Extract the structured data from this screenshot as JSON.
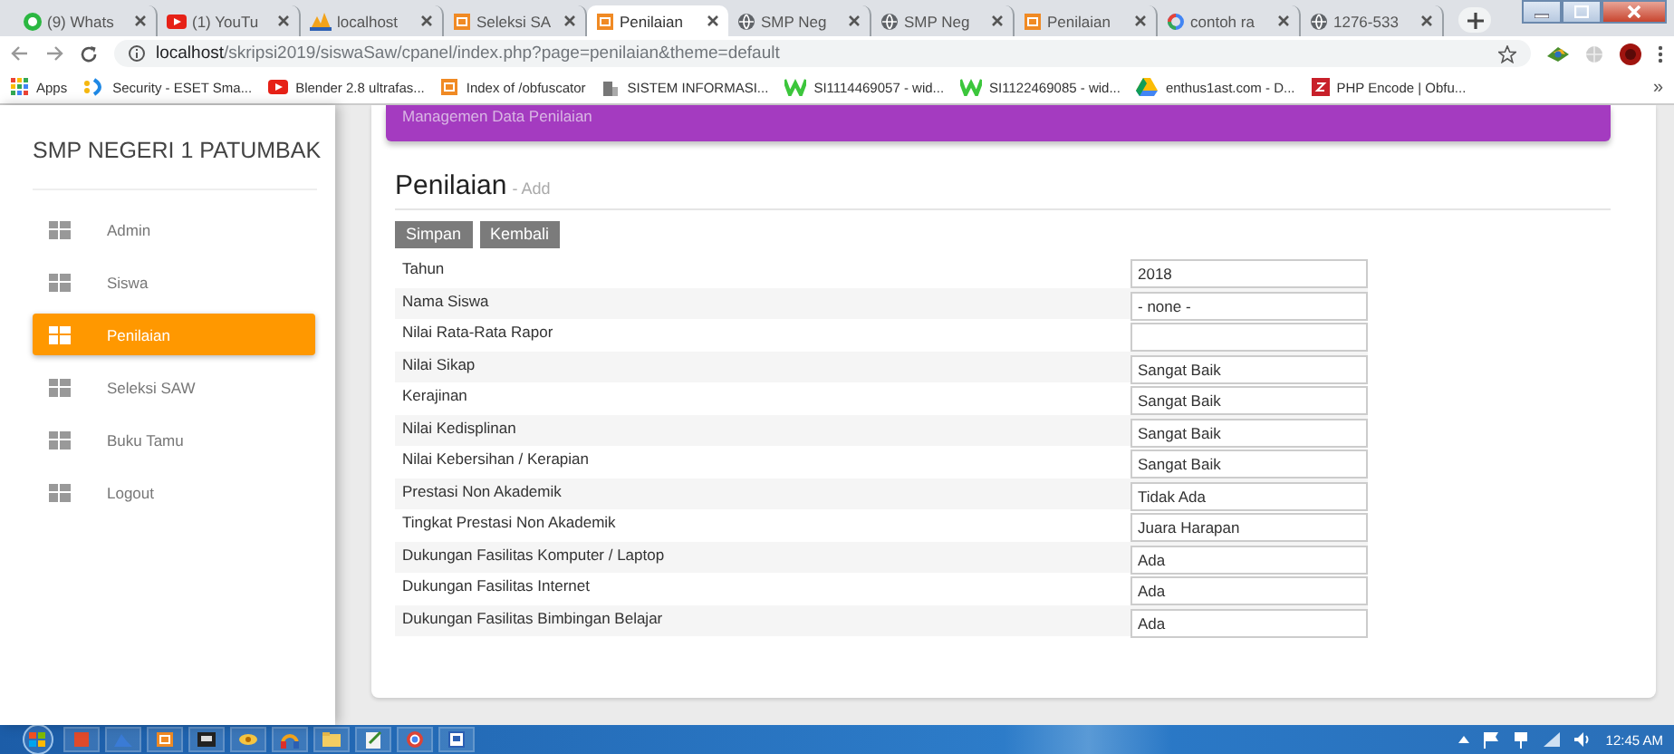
{
  "browser": {
    "tabs": [
      {
        "title": "(9) Whats",
        "kind": "whatsapp",
        "selected": false
      },
      {
        "title": "(1) YouTu",
        "kind": "youtube",
        "selected": false
      },
      {
        "title": "localhost",
        "kind": "mountain",
        "selected": false
      },
      {
        "title": "Seleksi SA",
        "kind": "square",
        "selected": false
      },
      {
        "title": "Penilaian",
        "kind": "square",
        "selected": true
      },
      {
        "title": "SMP Neg",
        "kind": "globe",
        "selected": false
      },
      {
        "title": "SMP Neg",
        "kind": "globe",
        "selected": false
      },
      {
        "title": "Penilaian",
        "kind": "square",
        "selected": false
      },
      {
        "title": "contoh ra",
        "kind": "ring",
        "selected": false
      },
      {
        "title": "1276-533",
        "kind": "globe",
        "selected": false
      }
    ],
    "address": {
      "host": "localhost",
      "path": "/skripsi2019/siswaSaw/cpanel/index.php?page=penilaian&theme=default"
    },
    "bookmarks": [
      {
        "label": "Apps",
        "kind": "grid"
      },
      {
        "label": "Security - ESET Sma...",
        "kind": "dots"
      },
      {
        "label": "Blender 2.8 ultrafas...",
        "kind": "youtube"
      },
      {
        "label": "Index of /obfuscator",
        "kind": "square"
      },
      {
        "label": "SISTEM INFORMASI...",
        "kind": "building"
      },
      {
        "label": "SI1114469057 - wid...",
        "kind": "w"
      },
      {
        "label": "SI1122469085 - wid...",
        "kind": "w"
      },
      {
        "label": "enthus1ast.com - D...",
        "kind": "drive"
      },
      {
        "label": "PHP Encode | Obfu...",
        "kind": "redbox"
      }
    ],
    "bookmarks_overflow": "»"
  },
  "sidebar": {
    "title": "SMP NEGERI 1 PATUMBAK",
    "items": [
      {
        "label": "Admin",
        "selected": false
      },
      {
        "label": "Siswa",
        "selected": false
      },
      {
        "label": "Penilaian",
        "selected": true
      },
      {
        "label": "Seleksi SAW",
        "selected": false
      },
      {
        "label": "Buku Tamu",
        "selected": false
      },
      {
        "label": "Logout",
        "selected": false
      }
    ]
  },
  "banner": "Managemen Data Penilaian",
  "heading": {
    "title": "Penilaian",
    "subtitle": "- Add"
  },
  "buttons": [
    "Simpan",
    "Kembali"
  ],
  "fields": [
    {
      "label": "Tahun",
      "value": "2018"
    },
    {
      "label": "Nama Siswa",
      "value": "- none -"
    },
    {
      "label": "Nilai Rata-Rata Rapor"
    },
    {
      "label": "Nilai Sikap",
      "value": "Sangat Baik"
    },
    {
      "label": "Kerajinan",
      "value": "Sangat Baik"
    },
    {
      "label": "Nilai Kedisplinan",
      "value": "Sangat Baik"
    },
    {
      "label": "Nilai Kebersihan / Kerapian",
      "value": "Sangat Baik"
    },
    {
      "label": "Prestasi Non Akademik",
      "value": "Tidak Ada"
    },
    {
      "label": "Tingkat Prestasi Non Akademik",
      "value": "Juara Harapan"
    },
    {
      "label": "Dukungan Fasilitas Komputer / Laptop",
      "value": "Ada"
    },
    {
      "label": "Dukungan Fasilitas Internet",
      "value": "Ada"
    },
    {
      "label": "Dukungan Fasilitas Bimbingan Belajar",
      "value": "Ada"
    }
  ],
  "taskbar": {
    "clock": "12:45 AM"
  }
}
